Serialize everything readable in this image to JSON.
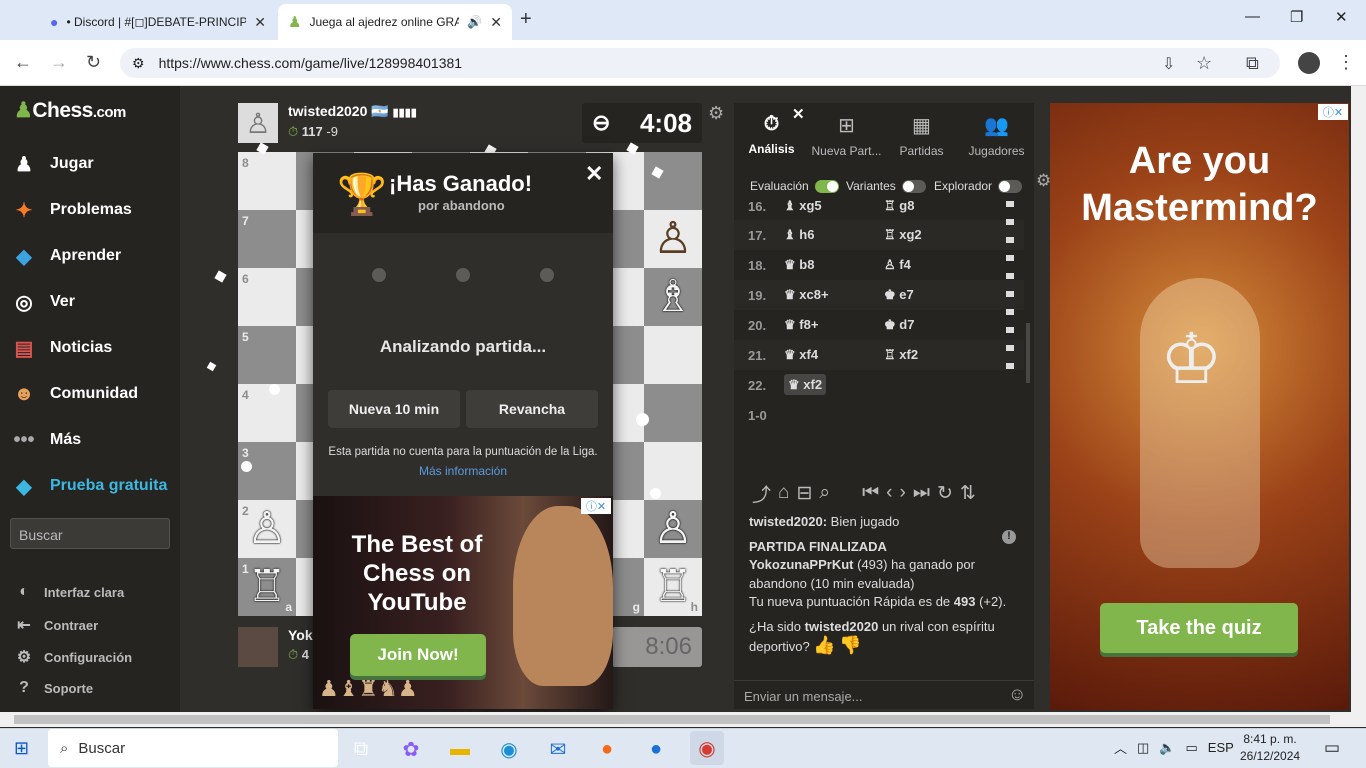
{
  "browser": {
    "tabs": [
      {
        "title": "• Discord | #[◻]DEBATE-PRINCIPAL",
        "close": "✕"
      },
      {
        "title": "Juega al ajedrez online GRA",
        "close": "✕"
      }
    ],
    "new_tab": "+",
    "url": "https://www.chess.com/game/live/128998401381"
  },
  "sidebar": {
    "logo": "Chess",
    "logo_suffix": ".com",
    "items": [
      {
        "label": "Jugar",
        "icon": "play-icon"
      },
      {
        "label": "Problemas",
        "icon": "puzzle-icon"
      },
      {
        "label": "Aprender",
        "icon": "learn-icon"
      },
      {
        "label": "Ver",
        "icon": "binoculars-icon"
      },
      {
        "label": "Noticias",
        "icon": "news-icon"
      },
      {
        "label": "Comunidad",
        "icon": "community-icon"
      },
      {
        "label": "Más",
        "icon": "more-icon"
      },
      {
        "label": "Prueba gratuita",
        "icon": "diamond-icon"
      }
    ],
    "search_placeholder": "Buscar",
    "bottom": [
      {
        "label": "Interfaz clara"
      },
      {
        "label": "Contraer"
      },
      {
        "label": "Configuración"
      },
      {
        "label": "Soporte"
      }
    ]
  },
  "game": {
    "top_player": {
      "name": "twisted2020",
      "flag": "🇦🇷",
      "bars": "▮▮▮▮",
      "rating": "117",
      "change": "-9",
      "clock": "4:08"
    },
    "bottom_player": {
      "name": "Yok",
      "rating": "4",
      "clock": "8:06"
    },
    "ranks": [
      "8",
      "7",
      "6",
      "5",
      "4",
      "3",
      "2",
      "1"
    ],
    "files_shown": [
      "a",
      "g",
      "h"
    ]
  },
  "modal": {
    "title": "¡Has Ganado!",
    "subtitle": "por abandono",
    "analyzing": "Analizando partida...",
    "btn_new": "Nueva 10 min",
    "btn_rematch": "Revancha",
    "note": "Esta partida no cuenta para la puntuación de la Liga.",
    "more": "Más información",
    "close": "✕",
    "ad": {
      "text": "The Best of Chess on YouTube",
      "button": "Join Now!"
    }
  },
  "panel": {
    "tabs": [
      {
        "label": "Análisis",
        "icon": "timer-icon"
      },
      {
        "label": "Nueva Part...",
        "icon": "plus-icon"
      },
      {
        "label": "Partidas",
        "icon": "board-icon"
      },
      {
        "label": "Jugadores",
        "icon": "players-icon"
      }
    ],
    "toggles": [
      {
        "label": "Evaluación",
        "on": true
      },
      {
        "label": "Variantes",
        "on": false
      },
      {
        "label": "Explorador",
        "on": false
      }
    ],
    "moves": [
      {
        "num": "16.",
        "w": "♝ xg5",
        "b": "♖ g8"
      },
      {
        "num": "17.",
        "w": "♝ h6",
        "b": "♖ xg2"
      },
      {
        "num": "18.",
        "w": "♛ b8",
        "b": "♙ f4"
      },
      {
        "num": "19.",
        "w": "♛ xc8+",
        "b": "♚ e7"
      },
      {
        "num": "20.",
        "w": "♛ f8+",
        "b": "♚ d7"
      },
      {
        "num": "21.",
        "w": "♛ xf4",
        "b": "♖ xf2"
      },
      {
        "num": "22.",
        "w": "♛ xf2",
        "b": ""
      }
    ],
    "result": "1-0",
    "chat": {
      "line1_user": "twisted2020:",
      "line1_text": " Bien jugado",
      "final": "PARTIDA FINALIZADA",
      "winner": "YokozunaPPrKut",
      "winner_rest": " (493) ha ganado por abandono (10 min evaluada)",
      "new_rating_pre": "Tu nueva puntuación Rápida es de ",
      "new_rating": "493",
      "new_rating_post": " (+2).",
      "q_pre": "¿Ha sido ",
      "q_user": "twisted2020",
      "q_post": " un rival con espíritu deportivo?"
    },
    "message_placeholder": "Enviar un mensaje..."
  },
  "ad_right": {
    "text": "Are you Mastermind?",
    "button": "Take the quiz"
  },
  "taskbar": {
    "search": "Buscar",
    "lang": "ESP",
    "time": "8:41 p. m.",
    "date": "26/12/2024"
  }
}
